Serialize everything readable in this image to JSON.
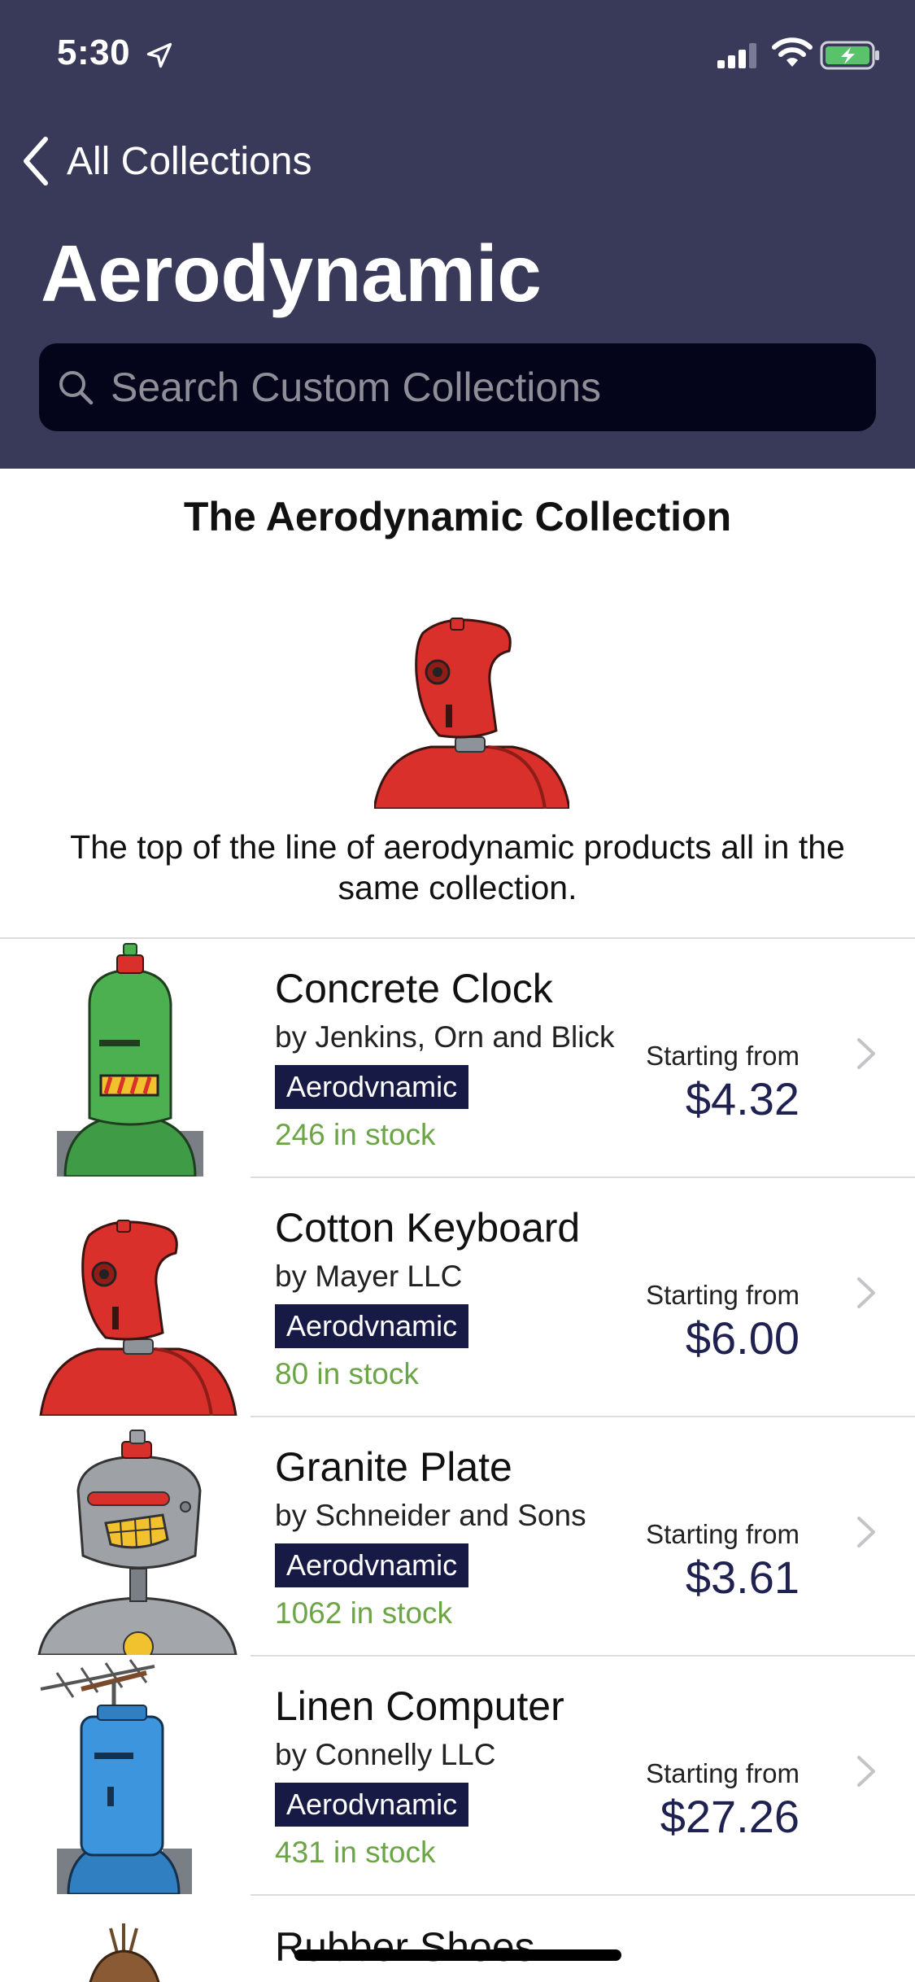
{
  "status_bar": {
    "time": "5:30",
    "icons": [
      "location-arrow-icon",
      "cellular-signal-icon",
      "wifi-icon",
      "battery-charging-icon"
    ]
  },
  "nav": {
    "back_label": "All Collections",
    "title": "Aerodynamic"
  },
  "search": {
    "placeholder": "Search Custom Collections"
  },
  "collection": {
    "heading": "The Aerodynamic Collection",
    "description": "The top of the line of aerodynamic products all in the same collection.",
    "image": "red-robot"
  },
  "products": [
    {
      "name": "Concrete Clock",
      "vendor": "by Jenkins, Orn and Blick",
      "tag": "Aerodvnamic",
      "stock": "246 in stock",
      "price_label": "Starting from",
      "price": "$4.32",
      "image": "green-robot"
    },
    {
      "name": "Cotton Keyboard",
      "vendor": "by Mayer LLC",
      "tag": "Aerodvnamic",
      "stock": "80 in stock",
      "price_label": "Starting from",
      "price": "$6.00",
      "image": "red-robot"
    },
    {
      "name": "Granite Plate",
      "vendor": "by Schneider and Sons",
      "tag": "Aerodvnamic",
      "stock": "1062 in stock",
      "price_label": "Starting from",
      "price": "$3.61",
      "image": "gray-robot"
    },
    {
      "name": "Linen Computer",
      "vendor": "by Connelly LLC",
      "tag": "Aerodvnamic",
      "stock": "431 in stock",
      "price_label": "Starting from",
      "price": "$27.26",
      "image": "blue-robot"
    }
  ],
  "partial_product": {
    "name": "Rubber Shoes",
    "image": "brown-robot"
  },
  "colors": {
    "header_bg": "#393a5a",
    "search_bg": "#04051a",
    "tag_bg": "#171a45",
    "stock_text": "#6ca545",
    "price_text": "#1f2250"
  }
}
